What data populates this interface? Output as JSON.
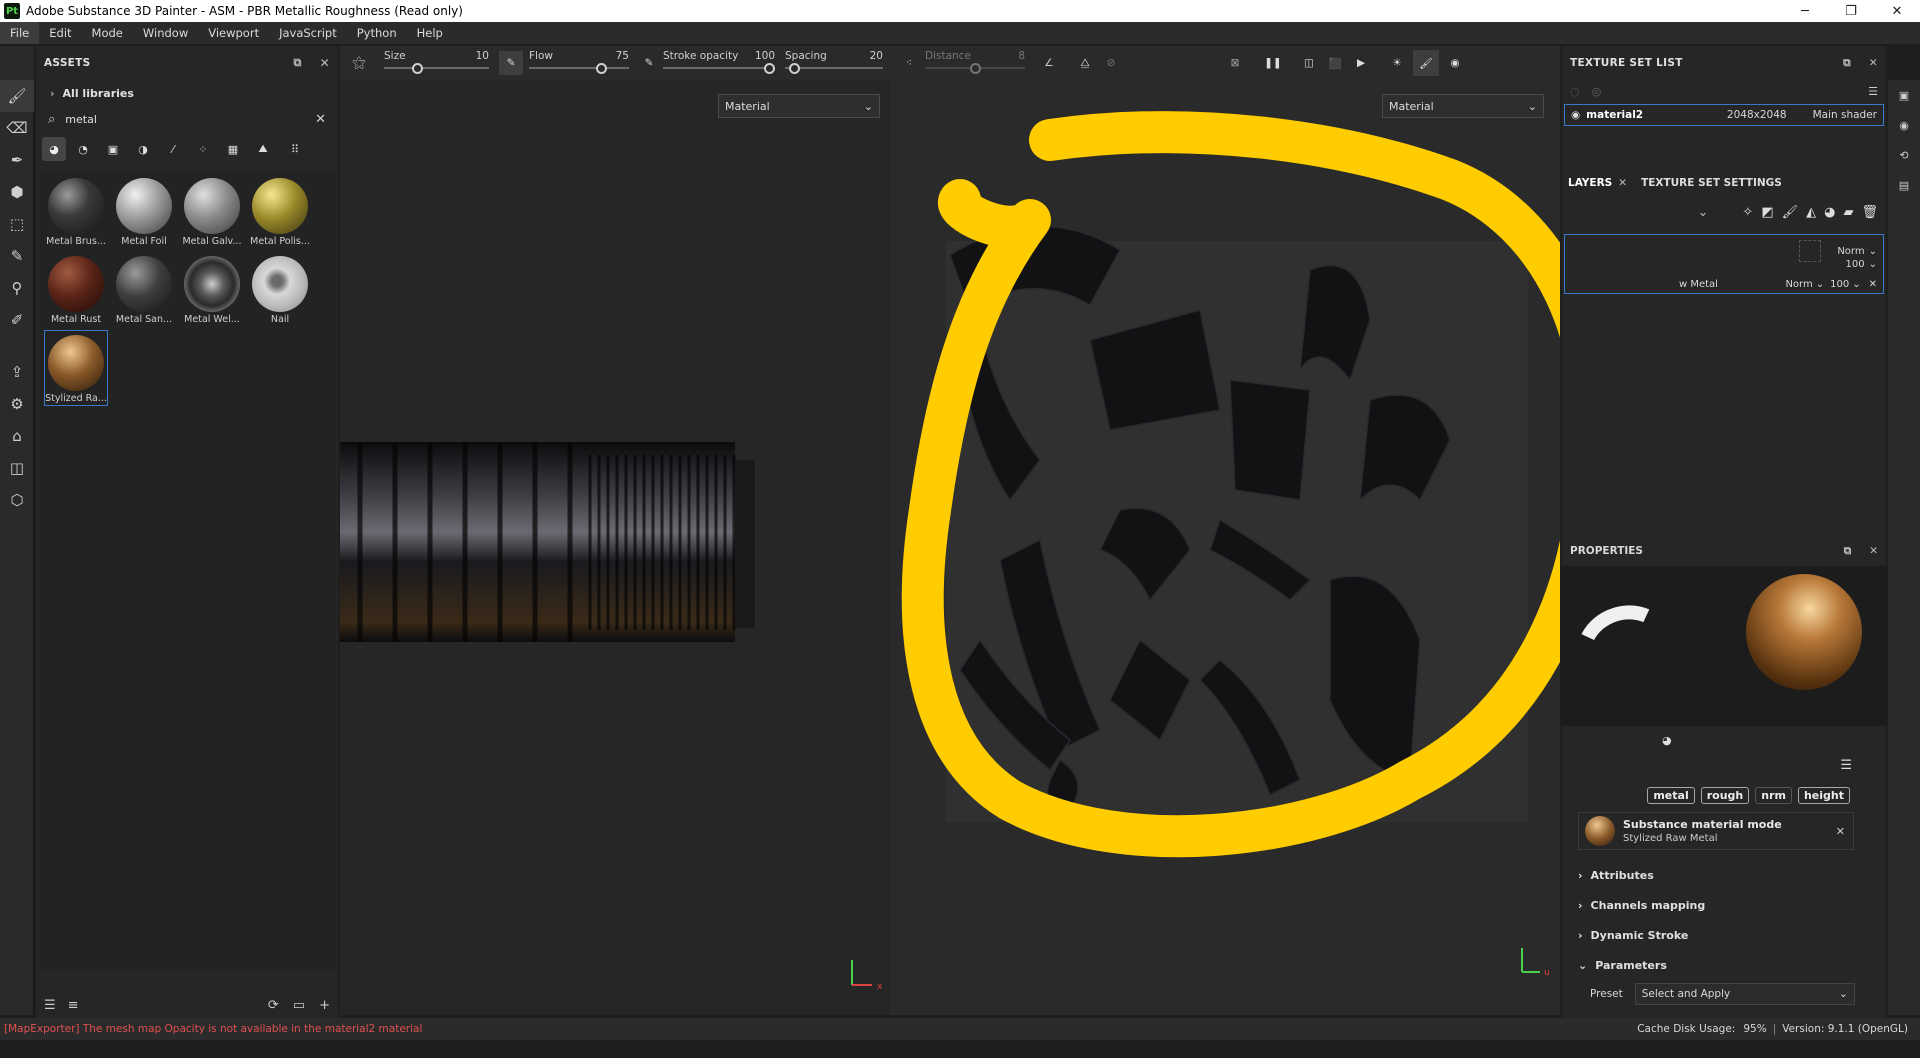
{
  "window": {
    "title": "Adobe Substance 3D Painter - ASM - PBR Metallic Roughness (Read only)",
    "logo": "Pt"
  },
  "menu": [
    "File",
    "Edit",
    "Mode",
    "Window",
    "Viewport",
    "JavaScript",
    "Python",
    "Help"
  ],
  "toolbar": {
    "size": {
      "label": "Size",
      "value": "10",
      "fraction": 0.3
    },
    "flow": {
      "label": "Flow",
      "value": "75",
      "fraction": 0.75
    },
    "stroke_opacity": {
      "label": "Stroke opacity",
      "value": "100",
      "fraction": 1.0
    },
    "spacing": {
      "label": "Spacing",
      "value": "20",
      "fraction": 0.05
    },
    "distance": {
      "label": "Distance",
      "value": "8",
      "fraction": 0.5
    }
  },
  "assets": {
    "title": "ASSETS",
    "library": "All libraries",
    "search_value": "metal",
    "items": [
      {
        "label": "Metal Brus...",
        "color": "#3a3a3c"
      },
      {
        "label": "Metal Foil",
        "color": "#9a9a9c"
      },
      {
        "label": "Metal Galv...",
        "color": "#8a8a8c"
      },
      {
        "label": "Metal Polis...",
        "color": "#9a8a2a"
      },
      {
        "label": "Metal Rust",
        "color": "#5a2418"
      },
      {
        "label": "Metal San...",
        "color": "#3e3e40"
      },
      {
        "label": "Metal Wel...",
        "color": "#5a5a5c"
      },
      {
        "label": "Nail",
        "color": "#b8b8ba"
      },
      {
        "label": "Stylized Ra...",
        "color": "#8a5a2a"
      }
    ]
  },
  "viewports": {
    "left_mode": "Material",
    "right_mode": "Material"
  },
  "texture_set_list": {
    "title": "TEXTURE SET LIST",
    "row": {
      "name": "material2",
      "resolution": "2048x2048",
      "shader": "Main shader"
    }
  },
  "layers": {
    "tab_layers": "LAYERS",
    "tab_texture_set": "TEXTURE SET SETTINGS",
    "group_blend": "Norm",
    "group_opacity": "100",
    "layer_name_partial": "w Metal",
    "layer_blend": "Norm",
    "layer_opacity": "100"
  },
  "properties": {
    "title": "PROPERTIES",
    "channels": [
      "metal",
      "rough",
      "nrm",
      "height"
    ],
    "material_mode_title": "Substance material mode",
    "material_mode_value": "Stylized Raw Metal",
    "sections": [
      "Attributes",
      "Channels mapping",
      "Dynamic Stroke",
      "Parameters"
    ],
    "preset_label": "Preset",
    "preset_value": "Select and Apply"
  },
  "status": {
    "message": "[MapExporter] The mesh map Opacity is not available in the material2 material",
    "cache": "Cache Disk Usage:",
    "cache_value": "95%",
    "version": "Version: 9.1.1 (OpenGL)"
  },
  "colors": {
    "annotation": "#ffcc00",
    "error": "#e05050",
    "accent": "#3a78c8"
  }
}
